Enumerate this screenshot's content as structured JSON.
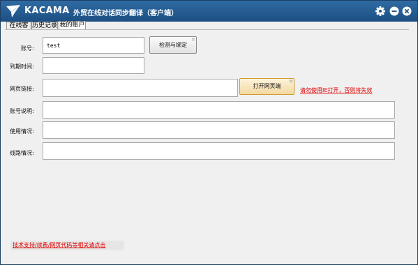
{
  "titlebar": {
    "brand": "KACAMA",
    "subtitle": "外贸在线对话同步翻译（客户端）",
    "accent_color": "#1f5387",
    "icons": [
      "app-logo-icon",
      "gear-icon",
      "minimize-icon",
      "close-icon"
    ]
  },
  "tabs": [
    {
      "label": "在线客服"
    },
    {
      "label": "历史记录"
    },
    {
      "label": "我的账户",
      "active": true
    }
  ],
  "form": {
    "account_label": "账号:",
    "account_value": "test",
    "check_bind_button": "检测与绑定",
    "expire_label": "到期时间:",
    "expire_value": "",
    "url_label": "网页链接:",
    "url_value": "",
    "open_page_button": "打开网页端",
    "url_warning": "请勿使用IE打开，否则将失效",
    "desc_label": "账号说明:",
    "desc_value": "",
    "usage_label": "使用情况:",
    "usage_value": "",
    "route_label": "线路情况:",
    "route_value": ""
  },
  "footer": {
    "link": "技术支持/续费/网页代码等相关请点击"
  }
}
